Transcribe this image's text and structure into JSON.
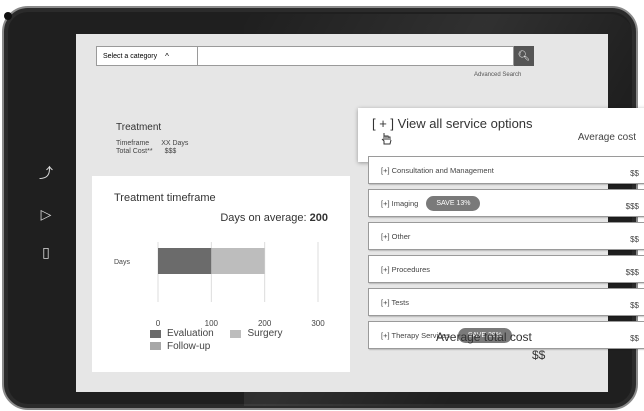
{
  "search": {
    "category_label": "Select a category",
    "query": "",
    "advanced_link": "Advanced Search"
  },
  "treatment": {
    "title": "Treatment",
    "timeframe_label": "Timeframe",
    "timeframe_value": "XX Days",
    "total_cost_label": "Total Cost**",
    "total_cost_value": "$$$"
  },
  "timeframe_card": {
    "title": "Treatment timeframe",
    "days_label": "Days on average:",
    "days_value": "200"
  },
  "chart_data": {
    "type": "bar",
    "orientation": "horizontal",
    "stacked": true,
    "categories": [
      "Days"
    ],
    "series": [
      {
        "name": "Evaluation",
        "values": [
          100
        ],
        "color": "#6b6b6b"
      },
      {
        "name": "Surgery",
        "values": [
          100
        ],
        "color": "#bdbdbd"
      },
      {
        "name": "Follow-up",
        "values": [
          0
        ],
        "color": "#a7a7a7"
      }
    ],
    "x_ticks": [
      "0",
      "100",
      "200",
      "300"
    ],
    "xlim": [
      0,
      300
    ],
    "grid": true,
    "legend": "bottom"
  },
  "popover": {
    "view_all": "[ + ] View all service options",
    "average_cost": "Average cost"
  },
  "services": [
    {
      "label": "[+] Consultation and Management",
      "price": "$$",
      "badge": ""
    },
    {
      "label": "[+] Imaging",
      "price": "$$$",
      "badge": "SAVE 13%"
    },
    {
      "label": "[+] Other",
      "price": "$$",
      "badge": ""
    },
    {
      "label": "[+] Procedures",
      "price": "$$$",
      "badge": ""
    },
    {
      "label": "[+] Tests",
      "price": "$$",
      "badge": ""
    },
    {
      "label": "[+] Therapy Services",
      "price": "$$",
      "badge": "SAVE 29%"
    }
  ],
  "total": {
    "label": "Average total cost",
    "value": "$$"
  },
  "icons": {
    "side_buttons": [
      "share-icon",
      "forward-icon",
      "document-icon"
    ]
  }
}
